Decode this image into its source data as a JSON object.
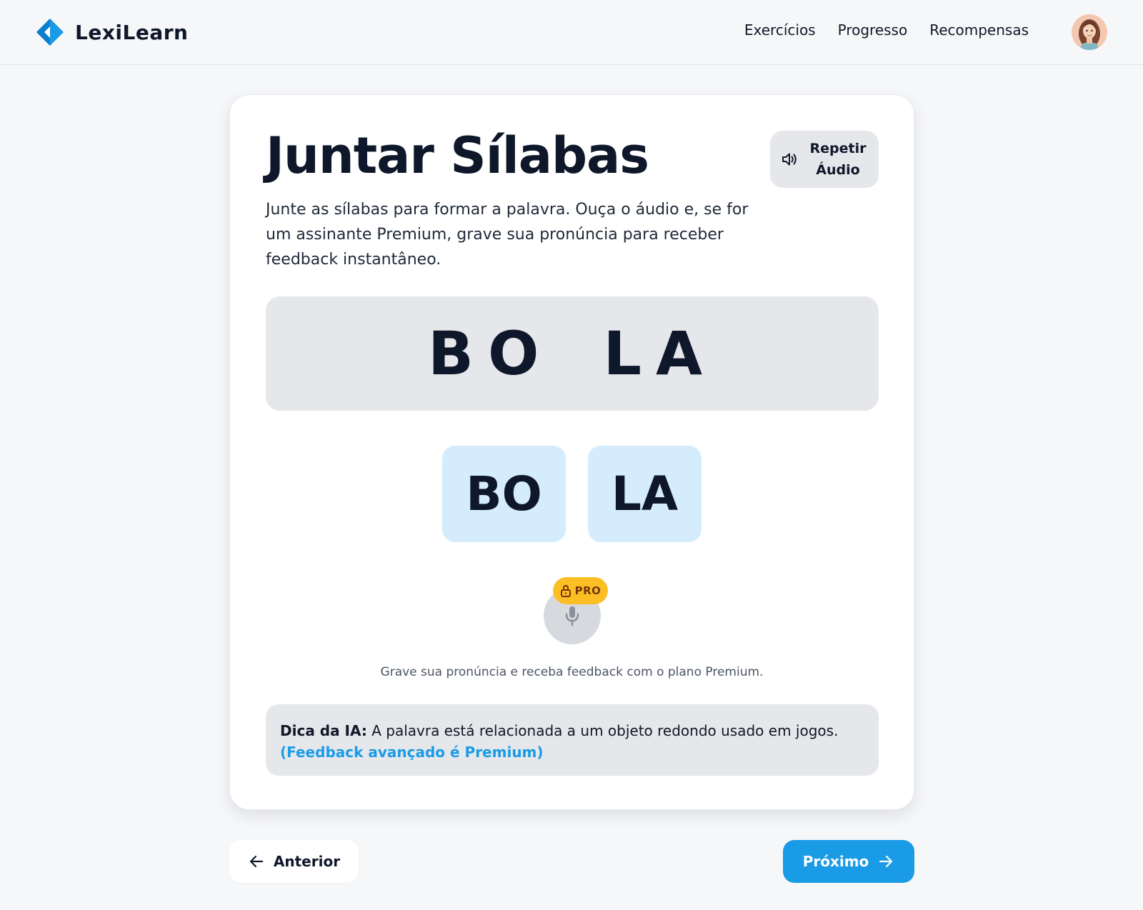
{
  "header": {
    "brand": "LexiLearn",
    "nav": [
      {
        "label": "Exercícios"
      },
      {
        "label": "Progresso"
      },
      {
        "label": "Recompensas"
      }
    ]
  },
  "exercise": {
    "title": "Juntar Sílabas",
    "repeat_audio_line1": "Repetir",
    "repeat_audio_line2": "Áudio",
    "instructions": "Junte as sílabas para formar a palavra. Ouça o áudio e, se for um assinante Premium, grave sua pronúncia para receber feedback instantâneo.",
    "word_syllables": [
      "BO",
      "LA"
    ],
    "tiles": [
      "BO",
      "LA"
    ],
    "pro_badge": "PRO",
    "mic_caption": "Grave sua pronúncia e receba feedback com o plano Premium.",
    "tip_label": "Dica da IA:",
    "tip_text": "A palavra está relacionada a um objeto redondo usado em jogos.",
    "tip_link": "(Feedback avançado é Premium)"
  },
  "footer": {
    "prev_label": "Anterior",
    "next_label": "Próximo"
  },
  "colors": {
    "accent": "#1a9be6",
    "tile_bg": "#d4ecfb",
    "pro_badge": "#fbbf24",
    "panel_bg": "#e5e7eb"
  },
  "icons": {
    "logo": "diamond-logo-icon",
    "repeat": "speaker-icon",
    "mic": "microphone-icon",
    "lock": "lock-icon",
    "prev": "arrow-left-icon",
    "next": "arrow-right-icon"
  }
}
